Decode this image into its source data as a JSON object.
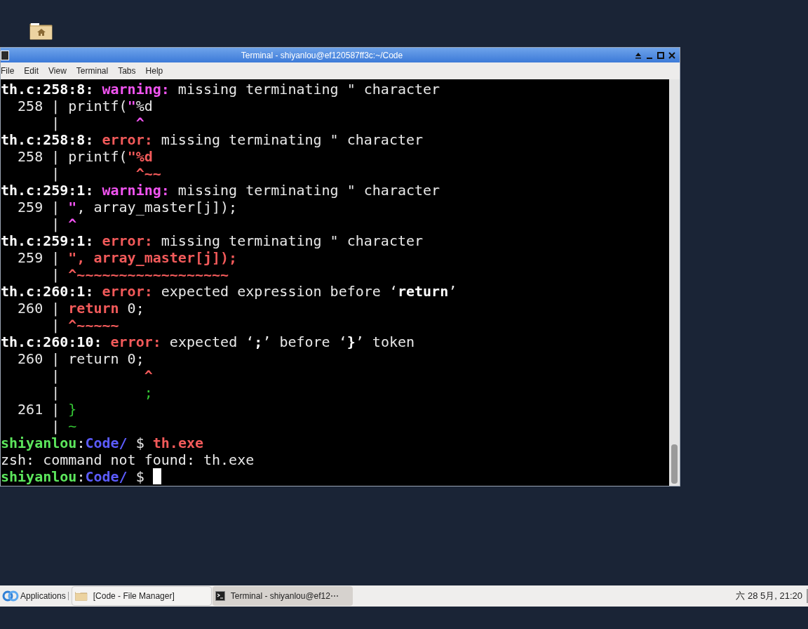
{
  "window": {
    "title": "Terminal - shiyanlou@ef120587ff3c:~/Code"
  },
  "menu": [
    "File",
    "Edit",
    "View",
    "Terminal",
    "Tabs",
    "Help"
  ],
  "terminal": {
    "lines": [
      [
        {
          "kind": "bold",
          "text": "th.c:258:8: "
        },
        {
          "kind": "magenta",
          "text": "warning:"
        },
        {
          "kind": "plain",
          "text": " missing terminating \" character"
        }
      ],
      [
        {
          "kind": "plain",
          "text": "  258 | printf("
        },
        {
          "kind": "magenta",
          "text": "\""
        },
        {
          "kind": "plain",
          "text": "%d"
        }
      ],
      [
        {
          "kind": "plain",
          "text": "      |        "
        },
        {
          "kind": "magenta",
          "text": " ^"
        }
      ],
      [
        {
          "kind": "bold",
          "text": "th.c:258:8: "
        },
        {
          "kind": "red",
          "text": "error:"
        },
        {
          "kind": "plain",
          "text": " missing terminating \" character"
        }
      ],
      [
        {
          "kind": "plain",
          "text": "  258 | printf("
        },
        {
          "kind": "red",
          "text": "\"%d"
        }
      ],
      [
        {
          "kind": "plain",
          "text": "      |        "
        },
        {
          "kind": "red",
          "text": " ^~~"
        }
      ],
      [
        {
          "kind": "bold",
          "text": "th.c:259:1: "
        },
        {
          "kind": "magenta",
          "text": "warning:"
        },
        {
          "kind": "plain",
          "text": " missing terminating \" character"
        }
      ],
      [
        {
          "kind": "plain",
          "text": "  259 | "
        },
        {
          "kind": "magenta",
          "text": "\""
        },
        {
          "kind": "plain",
          "text": ", array_master[j]);"
        }
      ],
      [
        {
          "kind": "plain",
          "text": "      | "
        },
        {
          "kind": "magenta",
          "text": "^"
        }
      ],
      [
        {
          "kind": "bold",
          "text": "th.c:259:1: "
        },
        {
          "kind": "red",
          "text": "error:"
        },
        {
          "kind": "plain",
          "text": " missing terminating \" character"
        }
      ],
      [
        {
          "kind": "plain",
          "text": "  259 | "
        },
        {
          "kind": "red",
          "text": "\", array_master[j]);"
        }
      ],
      [
        {
          "kind": "plain",
          "text": "      | "
        },
        {
          "kind": "red",
          "text": "^~~~~~~~~~~~~~~~~~~"
        }
      ],
      [
        {
          "kind": "bold",
          "text": "th.c:260:1: "
        },
        {
          "kind": "red",
          "text": "error:"
        },
        {
          "kind": "plain",
          "text": " expected expression before ‘"
        },
        {
          "kind": "bold",
          "text": "return"
        },
        {
          "kind": "plain",
          "text": "’"
        }
      ],
      [
        {
          "kind": "plain",
          "text": "  260 | "
        },
        {
          "kind": "red",
          "text": "return"
        },
        {
          "kind": "plain",
          "text": " 0;"
        }
      ],
      [
        {
          "kind": "plain",
          "text": "      | "
        },
        {
          "kind": "red",
          "text": "^~~~~~"
        }
      ],
      [
        {
          "kind": "bold",
          "text": "th.c:260:10: "
        },
        {
          "kind": "red",
          "text": "error:"
        },
        {
          "kind": "plain",
          "text": " expected ‘"
        },
        {
          "kind": "bold",
          "text": ";"
        },
        {
          "kind": "plain",
          "text": "’ before ‘"
        },
        {
          "kind": "bold",
          "text": "}"
        },
        {
          "kind": "plain",
          "text": "’ token"
        }
      ],
      [
        {
          "kind": "plain",
          "text": "  260 | return 0;"
        }
      ],
      [
        {
          "kind": "plain",
          "text": "      |         "
        },
        {
          "kind": "red",
          "text": " ^"
        }
      ],
      [
        {
          "kind": "plain",
          "text": "      |         "
        },
        {
          "kind": "green",
          "text": " ;"
        }
      ],
      [
        {
          "kind": "plain",
          "text": "  261 | "
        },
        {
          "kind": "green",
          "text": "}"
        }
      ],
      [
        {
          "kind": "plain",
          "text": "      | "
        },
        {
          "kind": "green",
          "text": "~"
        }
      ],
      [
        {
          "kind": "user",
          "text": "shiyanlou"
        },
        {
          "kind": "plain",
          "text": ":"
        },
        {
          "kind": "path",
          "text": "Code/"
        },
        {
          "kind": "plain",
          "text": " $ "
        },
        {
          "kind": "red",
          "text": "th.exe"
        }
      ],
      [
        {
          "kind": "plain",
          "text": "zsh: command not found: th.exe"
        }
      ],
      [
        {
          "kind": "user",
          "text": "shiyanlou"
        },
        {
          "kind": "plain",
          "text": ":"
        },
        {
          "kind": "path",
          "text": "Code/"
        },
        {
          "kind": "plain",
          "text": " $ "
        }
      ]
    ],
    "cursor": true
  },
  "taskbar": {
    "applications": "Applications",
    "tasks": [
      {
        "kind": "folder",
        "label": "[Code - File Manager]",
        "selected": false
      },
      {
        "kind": "terminal",
        "label": "Terminal - shiyanlou@ef12⋯",
        "selected": true
      }
    ],
    "clock": "六 28 5月, 21:20"
  }
}
